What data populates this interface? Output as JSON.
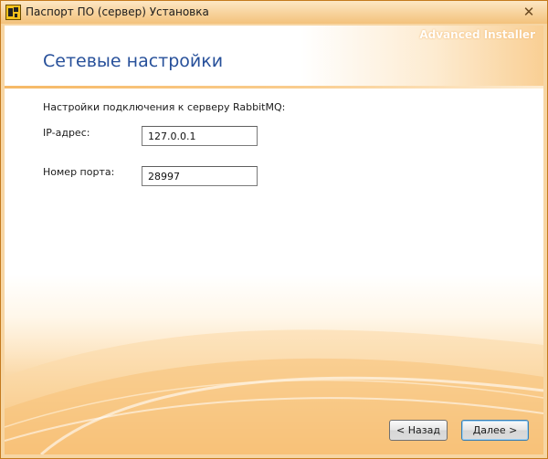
{
  "window": {
    "title": "Паспорт ПО (сервер) Установка",
    "close_symbol": "✕"
  },
  "header": {
    "brand": "Advanced Installer",
    "page_title": "Сетевые настройки"
  },
  "form": {
    "section_label": "Настройки подключения к серверу RabbitMQ:",
    "ip": {
      "label": "IP-адрес:",
      "value": "127.0.0.1"
    },
    "port": {
      "label": "Номер порта:",
      "value": "28997"
    }
  },
  "buttons": {
    "back": "< Назад",
    "next": "Далее >"
  },
  "icons": {
    "app": "installer-app-icon",
    "close": "close-icon"
  },
  "colors": {
    "title_accent": "#27509a",
    "window_frame": "#f7d29b",
    "footer_gradient": "#f4a94a"
  }
}
